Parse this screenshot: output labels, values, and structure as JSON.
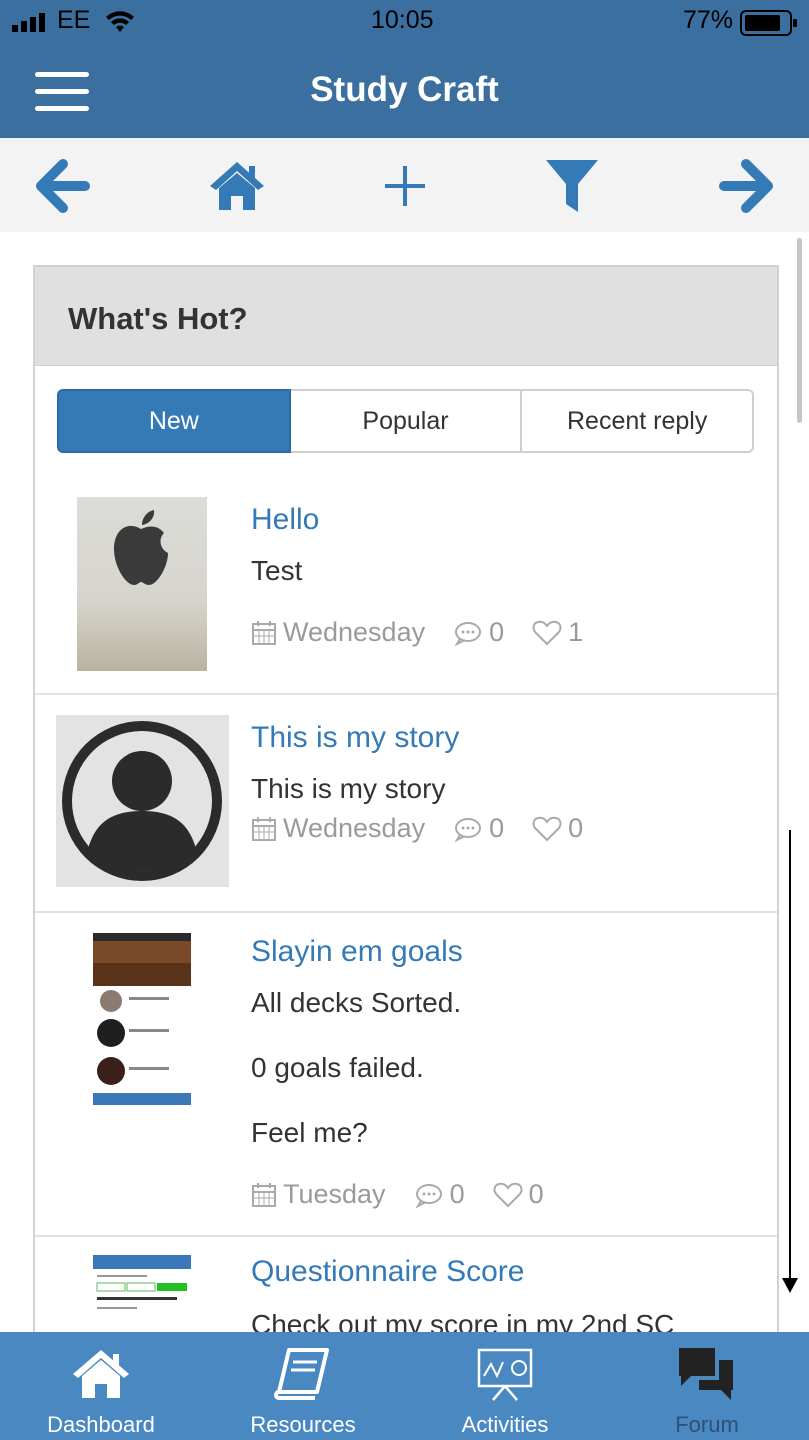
{
  "status": {
    "carrier": "EE",
    "time": "10:05",
    "battery": "77%"
  },
  "appbar": {
    "title": "Study Craft"
  },
  "toolbar": {
    "icons": [
      "back-arrow-icon",
      "home-icon",
      "plus-icon",
      "filter-icon",
      "forward-arrow-icon"
    ]
  },
  "section": {
    "title": "What's Hot?"
  },
  "tabs": [
    {
      "label": "New",
      "active": true
    },
    {
      "label": "Popular",
      "active": false
    },
    {
      "label": "Recent reply",
      "active": false
    }
  ],
  "posts": [
    {
      "title": "Hello",
      "text": [
        "Test"
      ],
      "day": "Wednesday",
      "comments": "0",
      "likes": "1"
    },
    {
      "title": "This is my story",
      "text": [
        "This is my story"
      ],
      "day": "Wednesday",
      "comments": "0",
      "likes": "0"
    },
    {
      "title": "Slayin em goals",
      "text": [
        "All decks Sorted.",
        "0 goals failed.",
        "Feel me?"
      ],
      "day": "Tuesday",
      "comments": "0",
      "likes": "0"
    },
    {
      "title": "Questionnaire Score",
      "text": [
        "Check out my score in my 2nd SC"
      ]
    }
  ],
  "bottom_nav": [
    {
      "label": "Dashboard",
      "icon": "home-icon"
    },
    {
      "label": "Resources",
      "icon": "book-icon"
    },
    {
      "label": "Activities",
      "icon": "presentation-board-icon"
    },
    {
      "label": "Forum",
      "icon": "chat-bubbles-icon"
    }
  ],
  "colors": {
    "primary": "#3a6f9f",
    "accent": "#337ab7",
    "tabbar": "#4a88c2"
  }
}
